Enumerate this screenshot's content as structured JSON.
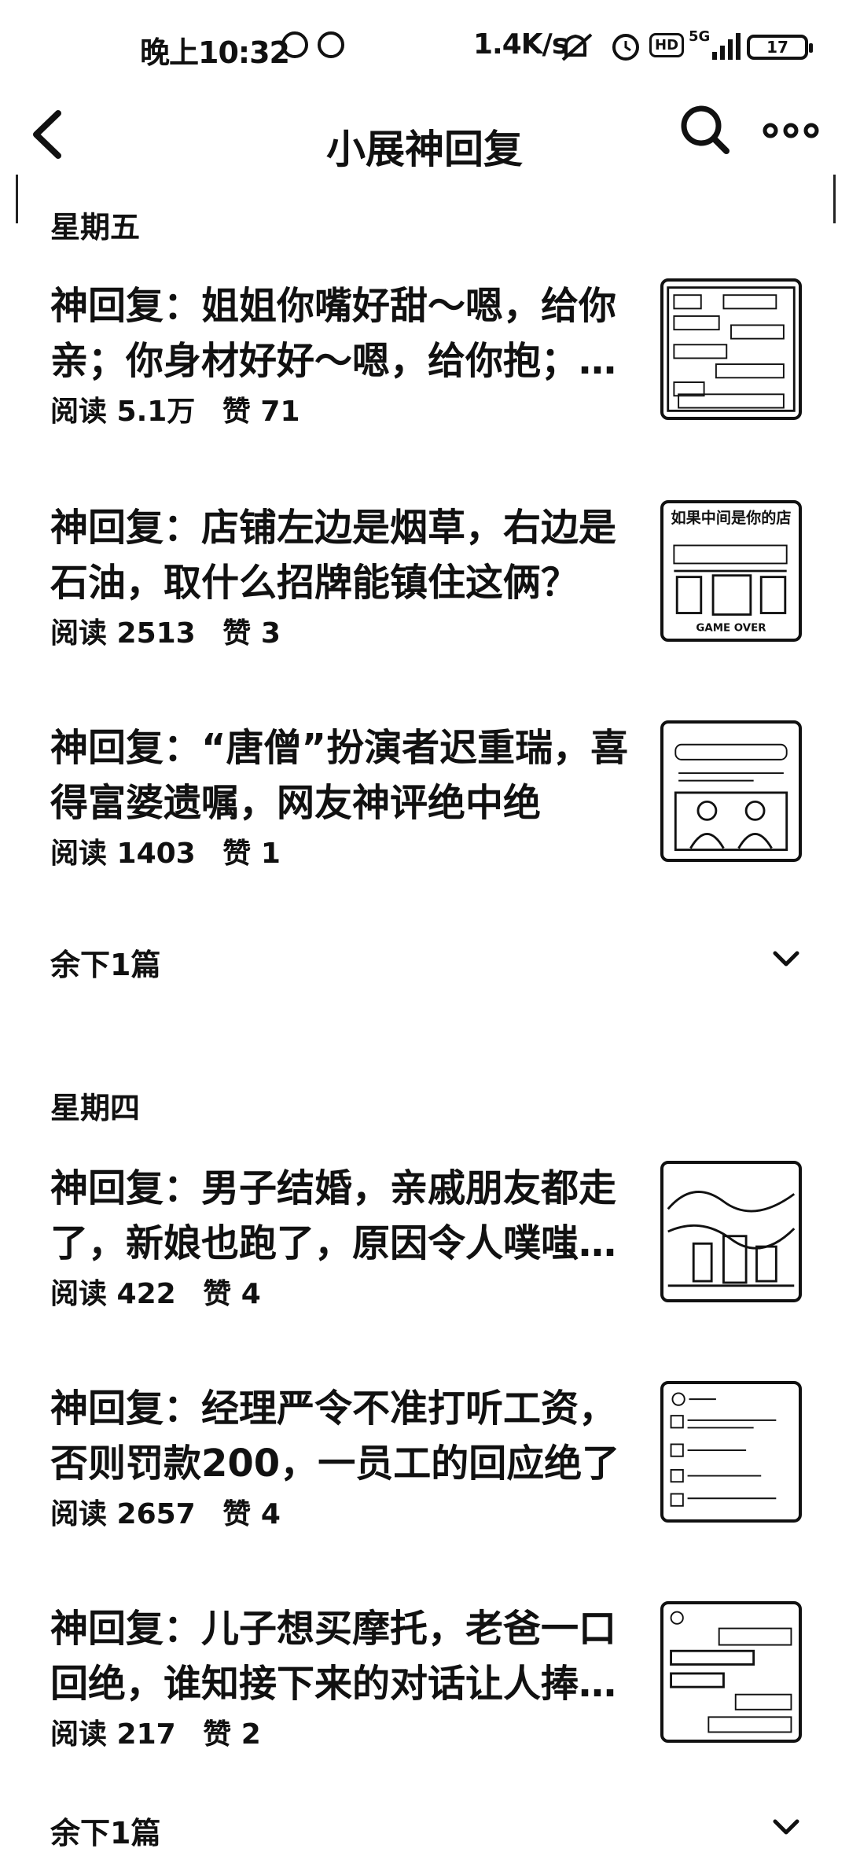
{
  "status_bar": {
    "time": "晚上10:32",
    "speed": "1.4K/s",
    "hd": "HD",
    "network": "5G",
    "battery": "17"
  },
  "nav": {
    "title": "小展神回复"
  },
  "sections": [
    {
      "day": "星期五",
      "articles": [
        {
          "title": "神回复：姐姐你嘴好甜～嗯，给你亲；你身材好好～嗯，给你抱；你生...",
          "reads": "阅读 5.1万",
          "likes": "赞 71"
        },
        {
          "title": "神回复：店铺左边是烟草，右边是石油，取什么招牌能镇住这俩？",
          "reads": "阅读 2513",
          "likes": "赞 3"
        },
        {
          "title": "神回复：“唐僧”扮演者迟重瑞，喜得富婆遗嘱，网友神评绝中绝",
          "reads": "阅读 1403",
          "likes": "赞 1"
        }
      ],
      "remaining": "余下1篇"
    },
    {
      "day": "星期四",
      "articles": [
        {
          "title": "神回复：男子结婚，亲戚朋友都走了，新娘也跑了，原因令人噗嗤一笑",
          "reads": "阅读 422",
          "likes": "赞 4"
        },
        {
          "title": "神回复：经理严令不准打听工资，否则罚款200，一员工的回应绝了",
          "reads": "阅读 2657",
          "likes": "赞 4"
        },
        {
          "title": "神回复：儿子想买摩托，老爸一口回绝，谁知接下来的对话让人捧腹大笑",
          "reads": "阅读 217",
          "likes": "赞 2"
        }
      ],
      "remaining": "余下1篇"
    }
  ],
  "thumbnails": {
    "thumb2_headline": "如果中间是你的店",
    "thumb2_caption": "GAME OVER"
  }
}
